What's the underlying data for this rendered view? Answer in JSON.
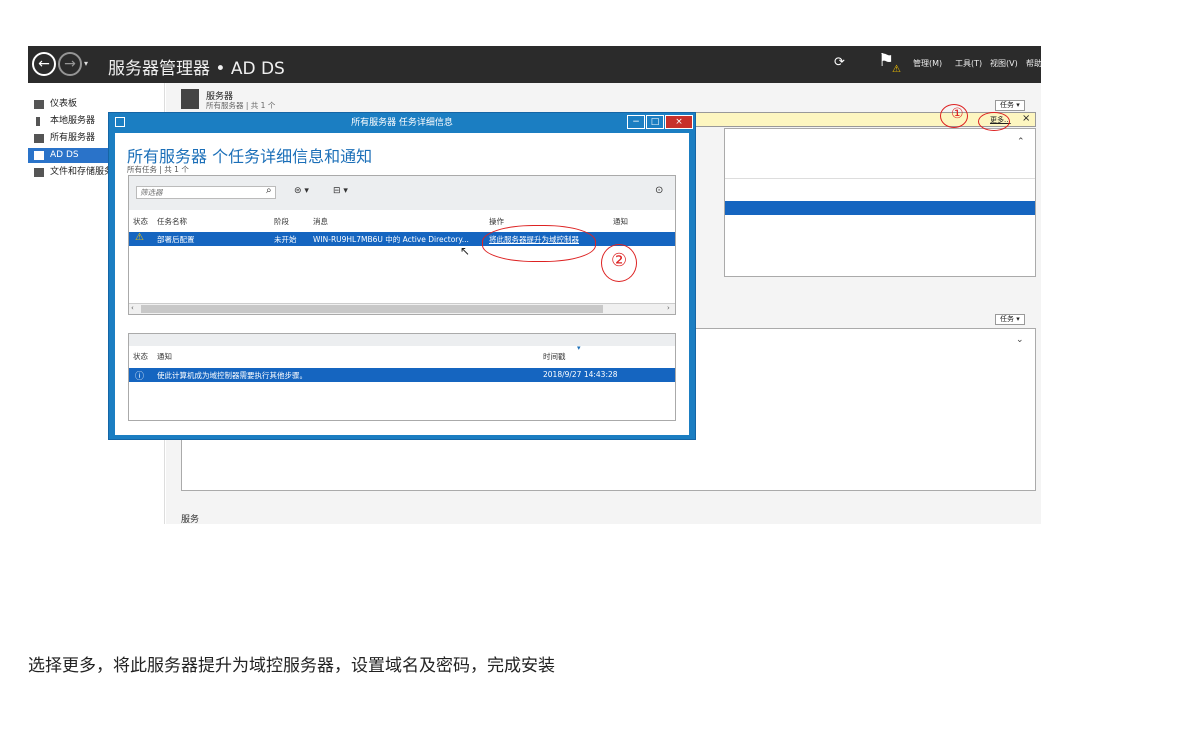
{
  "window": {
    "title": "服务器管理器 • AD DS",
    "menu": [
      "管理(M)",
      "工具(T)",
      "视图(V)",
      "帮助"
    ]
  },
  "sidebar": {
    "items": [
      {
        "label": "仪表板"
      },
      {
        "label": "本地服务器"
      },
      {
        "label": "所有服务器"
      },
      {
        "label": "AD DS"
      },
      {
        "label": "文件和存储服务"
      }
    ]
  },
  "servers_tile": {
    "title": "服务器",
    "subtitle": "所有服务器 | 共 1 个",
    "tasks_label": "任务",
    "more_label": "更多...",
    "close_label": "×",
    "tasks_label_2": "任务"
  },
  "services_label": "服务",
  "dialog": {
    "title": "所有服务器 任务详细信息",
    "heading": "所有服务器 个任务详细信息和通知",
    "subheading": "所有任务 | 共 1 个",
    "filter_placeholder": "筛选器",
    "columns": [
      "状态",
      "任务名称",
      "阶段",
      "消息",
      "操作",
      "通知"
    ],
    "row": {
      "task": "部署后配置",
      "stage": "未开始",
      "message": "WIN-RU9HL7MB6U 中的 Active Directory...",
      "action": "将此服务器提升为域控制器"
    },
    "notif_columns": [
      "状态",
      "通知",
      "时间戳"
    ],
    "notif_row": {
      "text": "使此计算机成为域控制器需要执行其他步骤。",
      "time": "2018/9/27 14:43:28"
    }
  },
  "annotations": [
    "①",
    "②"
  ],
  "caption": "选择更多，将此服务器提升为域控服务器，设置域名及密码，完成安装",
  "colors": {
    "accent": "#1b7ec2",
    "selection": "#1565c0",
    "titlebar": "#2b2b2b",
    "annotation": "#dd2222"
  }
}
